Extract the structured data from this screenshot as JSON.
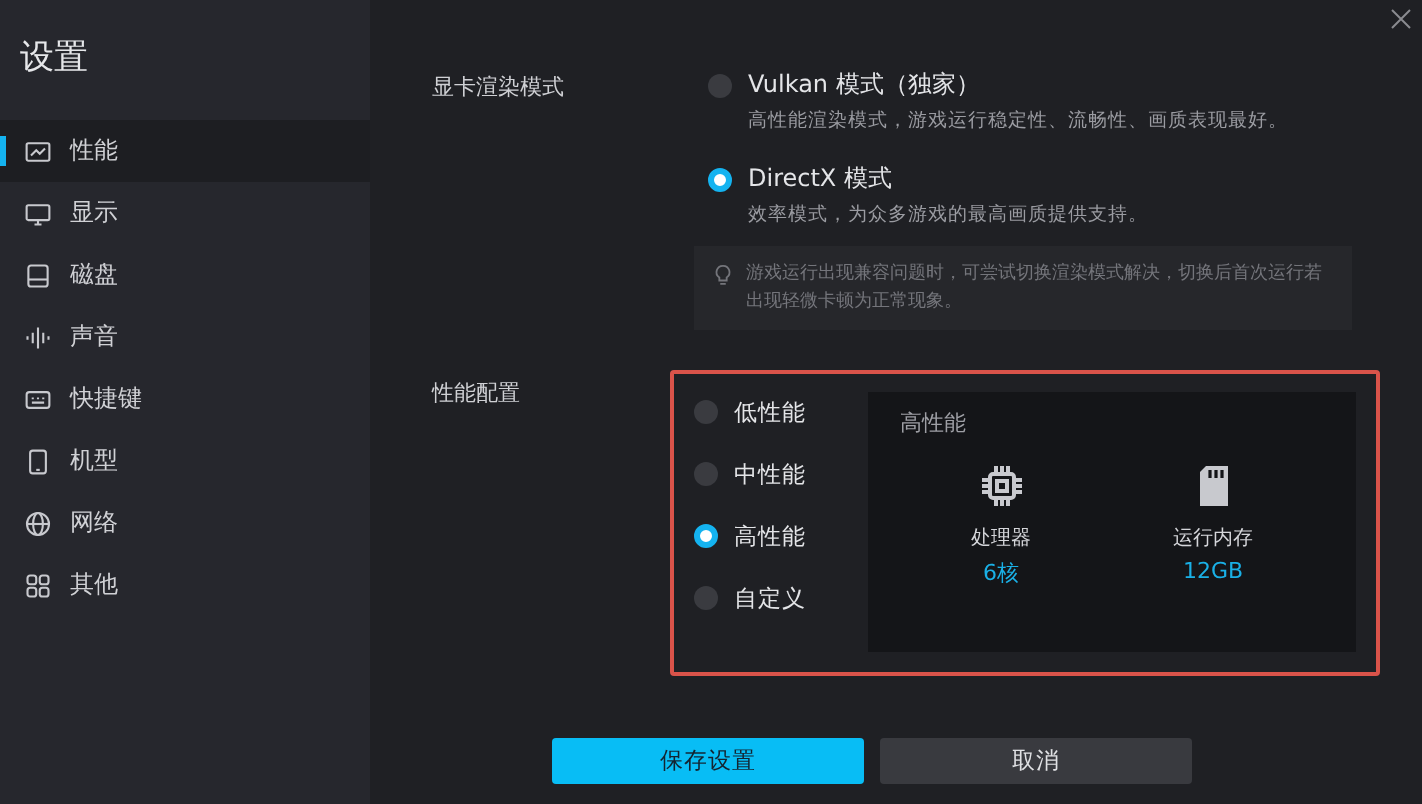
{
  "sidebar": {
    "title": "设置",
    "items": [
      {
        "label": "性能",
        "selected": true
      },
      {
        "label": "显示",
        "selected": false
      },
      {
        "label": "磁盘",
        "selected": false
      },
      {
        "label": "声音",
        "selected": false
      },
      {
        "label": "快捷键",
        "selected": false
      },
      {
        "label": "机型",
        "selected": false
      },
      {
        "label": "网络",
        "selected": false
      },
      {
        "label": "其他",
        "selected": false
      }
    ]
  },
  "render_mode": {
    "label": "显卡渲染模式",
    "options": [
      {
        "label": "Vulkan 模式（独家）",
        "description": "高性能渲染模式，游戏运行稳定性、流畅性、画质表现最好。",
        "selected": false
      },
      {
        "label": "DirectX 模式",
        "description": "效率模式，为众多游戏的最高画质提供支持。",
        "selected": true
      }
    ],
    "tip": "游戏运行出现兼容问题时，可尝试切换渲染模式解决，切换后首次运行若出现轻微卡顿为正常现象。"
  },
  "performance": {
    "label": "性能配置",
    "options": [
      {
        "label": "低性能",
        "selected": false
      },
      {
        "label": "中性能",
        "selected": false
      },
      {
        "label": "高性能",
        "selected": true
      },
      {
        "label": "自定义",
        "selected": false
      }
    ],
    "panel": {
      "title": "高性能",
      "specs": [
        {
          "name": "处理器",
          "value": "6核"
        },
        {
          "name": "运行内存",
          "value": "12GB"
        }
      ]
    }
  },
  "buttons": [
    {
      "label": "保存设置",
      "kind": "primary"
    },
    {
      "label": "取消",
      "kind": "secondary"
    }
  ]
}
